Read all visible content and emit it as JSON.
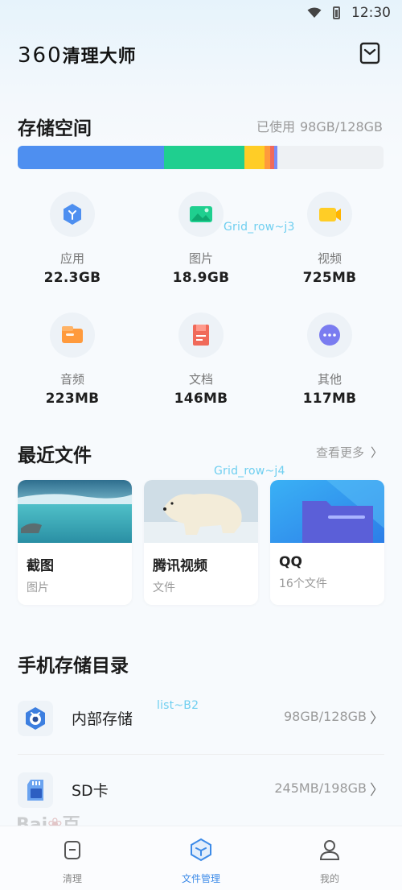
{
  "status_bar": {
    "time": "12:30",
    "icons": [
      "wifi-icon",
      "battery-icon"
    ]
  },
  "header": {
    "app_title_num": "360",
    "app_title_text": "清理大师",
    "mail_icon": "mail-icon"
  },
  "storage": {
    "title": "存储空间",
    "used_label": "已使用",
    "used_value": "98GB/128GB",
    "segments": [
      {
        "name": "应用",
        "fraction": 0.4,
        "color": "#4e8ff0"
      },
      {
        "name": "图片",
        "fraction": 0.22,
        "color": "#1fcf8f"
      },
      {
        "name": "视频",
        "fraction": 0.055,
        "color": "#ffcd26"
      },
      {
        "name": "音频",
        "fraction": 0.015,
        "color": "#ff9a3c"
      },
      {
        "name": "文档",
        "fraction": 0.012,
        "color": "#f06a5a"
      },
      {
        "name": "其他",
        "fraction": 0.008,
        "color": "#7a8cf5"
      }
    ],
    "bar_track_color": "#eef1f4"
  },
  "categories": [
    {
      "label": "应用",
      "value": "22.3GB",
      "icon": "app-icon",
      "color": "#4e8ff0"
    },
    {
      "label": "图片",
      "value": "18.9GB",
      "icon": "image-icon",
      "color": "#1fcf8f"
    },
    {
      "label": "视频",
      "value": "725MB",
      "icon": "video-icon",
      "color": "#ffcd26"
    },
    {
      "label": "音频",
      "value": "223MB",
      "icon": "audio-icon",
      "color": "#ff9a3c"
    },
    {
      "label": "文档",
      "value": "146MB",
      "icon": "document-icon",
      "color": "#f06a5a"
    },
    {
      "label": "其他",
      "value": "117MB",
      "icon": "more-icon",
      "color": "#7a7cf0"
    }
  ],
  "overlay_tags": {
    "grid_j3": "Grid_row~j3",
    "grid_j4": "Grid_row~j4",
    "list_b2": "list~B2"
  },
  "recent": {
    "title": "最近文件",
    "see_more": "查看更多",
    "cards": [
      {
        "title": "截图",
        "sub": "图片",
        "thumb": "sea-photo"
      },
      {
        "title": "腾讯视频",
        "sub": "文件",
        "thumb": "polar-bear-photo"
      },
      {
        "title": "QQ",
        "sub": "16个文件",
        "thumb": "folder-illustration"
      }
    ]
  },
  "directory": {
    "title": "手机存储目录",
    "items": [
      {
        "name": "内部存储",
        "value": "98GB/128GB",
        "icon": "internal-storage-icon"
      },
      {
        "name": "SD卡",
        "value": "245MB/198GB",
        "icon": "sd-card-icon"
      }
    ]
  },
  "bottom_nav": [
    {
      "label": "清理",
      "icon": "clean-icon",
      "active": false
    },
    {
      "label": "文件管理",
      "icon": "file-manager-icon",
      "active": true
    },
    {
      "label": "我的",
      "icon": "profile-icon",
      "active": false
    }
  ],
  "watermark_fragment": "Bai 百",
  "accent_color": "#3d8be8"
}
